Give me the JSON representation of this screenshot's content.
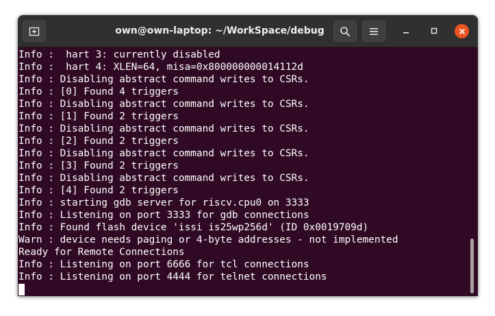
{
  "window": {
    "title": "own@own-laptop: ~/WorkSpace/debug"
  },
  "icons": {
    "new_tab": "new-tab-icon",
    "search": "search-icon",
    "menu": "hamburger-menu-icon",
    "minimize": "minimize-icon",
    "maximize": "maximize-icon",
    "close": "close-icon"
  },
  "colors": {
    "titlebar_bg": "#303030",
    "terminal_bg": "#300a24",
    "terminal_fg": "#ffffff",
    "close_button": "#e95420"
  },
  "terminal": {
    "lines": [
      "Info :  hart 3: currently disabled",
      "Info :  hart 4: XLEN=64, misa=0x800000000014112d",
      "Info : Disabling abstract command writes to CSRs.",
      "Info : [0] Found 4 triggers",
      "Info : Disabling abstract command writes to CSRs.",
      "Info : [1] Found 2 triggers",
      "Info : Disabling abstract command writes to CSRs.",
      "Info : [2] Found 2 triggers",
      "Info : Disabling abstract command writes to CSRs.",
      "Info : [3] Found 2 triggers",
      "Info : Disabling abstract command writes to CSRs.",
      "Info : [4] Found 2 triggers",
      "Info : starting gdb server for riscv.cpu0 on 3333",
      "Info : Listening on port 3333 for gdb connections",
      "Info : Found flash device 'issi is25wp256d' (ID 0x0019709d)",
      "Warn : device needs paging or 4-byte addresses - not implemented",
      "Ready for Remote Connections",
      "Info : Listening on port 6666 for tcl connections",
      "Info : Listening on port 4444 for telnet connections"
    ]
  }
}
